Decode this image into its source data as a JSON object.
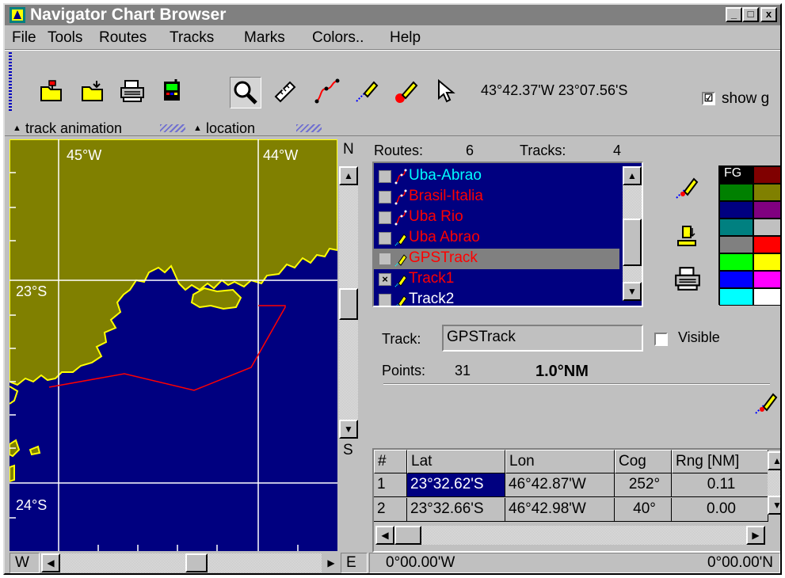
{
  "window": {
    "title": "Navigator Chart Browser"
  },
  "menu": [
    "File",
    "Tools",
    "Routes",
    "Tracks",
    "Marks",
    "Colors..",
    "Help"
  ],
  "toolbar": {
    "coordinates": "43°42.37'W 23°07.56'S",
    "show_label": "show g",
    "show_checked": "☑"
  },
  "tabs": [
    "track animation",
    "location"
  ],
  "map": {
    "lon_labels": [
      "45°W",
      "44°W"
    ],
    "lat_labels": [
      "23°S",
      "24°S"
    ],
    "colors": {
      "land": "#808000",
      "water": "#000080",
      "coast": "#ffff00",
      "grid": "#ffffff",
      "track": "#ff0000"
    }
  },
  "scroll": {
    "north": "N",
    "south": "S",
    "west": "W",
    "east": "E"
  },
  "panel": {
    "routes_label": "Routes:",
    "routes_count": "6",
    "tracks_label": "Tracks:",
    "tracks_count": "4",
    "items": [
      {
        "name": "Uba-Abrao",
        "color": "#00ffff",
        "kind": "route",
        "checked": ""
      },
      {
        "name": "Brasil-Italia",
        "color": "#ff0000",
        "kind": "route",
        "checked": ""
      },
      {
        "name": "Uba Rio",
        "color": "#ff0000",
        "kind": "route",
        "checked": ""
      },
      {
        "name": "Uba Abrao",
        "color": "#ff0000",
        "kind": "track",
        "checked": ""
      },
      {
        "name": "GPSTrack",
        "color": "#ff0000",
        "kind": "track",
        "checked": "",
        "selected": true
      },
      {
        "name": "Track1",
        "color": "#ff0000",
        "kind": "track",
        "checked": "×"
      },
      {
        "name": "Track2",
        "color": "#ffffff",
        "kind": "track",
        "checked": ""
      }
    ],
    "fg_label": "FG",
    "palette": [
      "#000000",
      "#800000",
      "#008000",
      "#808000",
      "#000080",
      "#800080",
      "#008080",
      "#c0c0c0",
      "#808080",
      "#ff0000",
      "#00ff00",
      "#ffff00",
      "#0000ff",
      "#ff00ff",
      "#00ffff",
      "#ffffff"
    ],
    "track_label": "Track:",
    "track_name": "GPSTrack",
    "visible_label": "Visible",
    "points_label": "Points:",
    "points_count": "31",
    "distance": "1.0°NM",
    "table": {
      "headers": [
        "#",
        "Lat",
        "Lon",
        "Cog",
        "Rng [NM]"
      ],
      "rows": [
        [
          "1",
          "23°32.62'S",
          "46°42.87'W",
          "252°",
          "0.11"
        ],
        [
          "2",
          "23°32.66'S",
          "46°42.98'W",
          "40°",
          "0.00"
        ]
      ]
    }
  },
  "status": {
    "left": "0°00.00'W",
    "right": "0°00.00'N"
  }
}
